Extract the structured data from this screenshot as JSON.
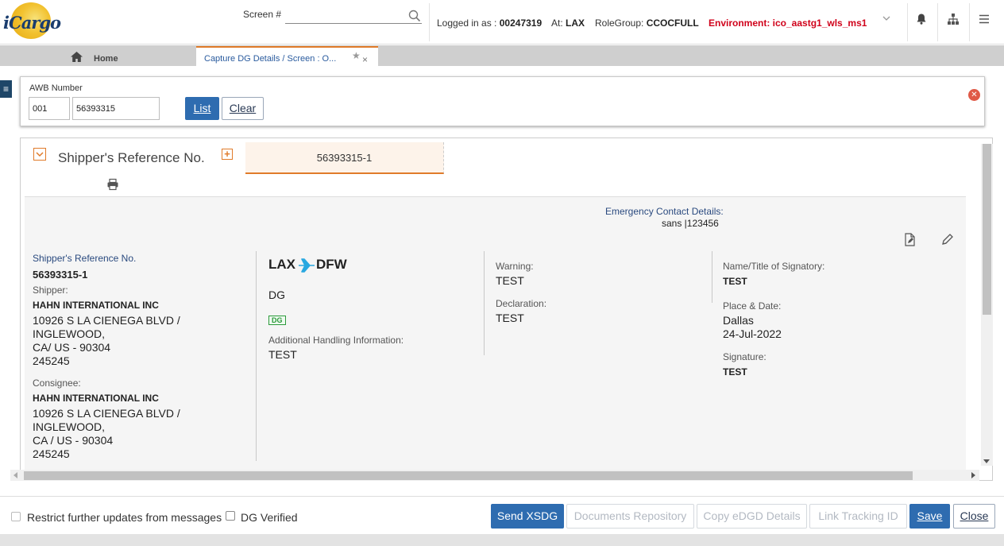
{
  "header": {
    "logo_text": "iCargo",
    "screen_label": "Screen #",
    "screen_value": "",
    "logged_in_label": "Logged in as :",
    "logged_in_value": "00247319",
    "at_label": "At:",
    "at_value": "LAX",
    "rolegroup_label": "RoleGroup:",
    "rolegroup_value": "CCOCFULL",
    "environment": "Environment: ico_aastg1_wls_ms1"
  },
  "tabs": {
    "home_label": "Home",
    "active_label": "Capture DG Details / Screen : O..."
  },
  "awb": {
    "label": "AWB Number",
    "prefix": "001",
    "number": "56393315",
    "list_label": "List",
    "clear_label": "Clear"
  },
  "section": {
    "title": "Shipper's Reference No.",
    "ref_tab": "56393315-1"
  },
  "emergency": {
    "label": "Emergency Contact Details:",
    "value": "sans |123456"
  },
  "shipment": {
    "ref_label": "Shipper's Reference No.",
    "ref_value": "56393315-1",
    "shipper_label": "Shipper:",
    "shipper_name": "HAHN INTERNATIONAL INC",
    "shipper_addr1": "10926 S LA CIENEGA BLVD /",
    "shipper_addr2": "INGLEWOOD,",
    "shipper_addr3": "CA/ US - 90304",
    "shipper_addr4": "245245",
    "consignee_label": "Consignee:",
    "consignee_name": "HAHN INTERNATIONAL INC",
    "consignee_addr1": "10926 S LA CIENEGA BLVD /",
    "consignee_addr2": "INGLEWOOD,",
    "consignee_addr3": "CA / US - 90304",
    "consignee_addr4": "245245"
  },
  "route": {
    "origin": "LAX",
    "destination": "DFW",
    "type": "DG",
    "badge": "DG",
    "handling_label": "Additional Handling Information:",
    "handling_value": "TEST"
  },
  "warning": {
    "warning_label": "Warning:",
    "warning_value": "TEST",
    "declaration_label": "Declaration:",
    "declaration_value": "TEST"
  },
  "signatory": {
    "name_label": "Name/Title of Signatory:",
    "name_value": "TEST",
    "place_label": "Place & Date:",
    "place_value": "Dallas",
    "date_value": "24-Jul-2022",
    "signature_label": "Signature:",
    "signature_value": "TEST"
  },
  "footer": {
    "restrict_label": "Restrict further updates from messages",
    "dg_verified_label": "DG Verified",
    "send_xsdg": "Send XSDG",
    "documents_repository": "Documents Repository",
    "copy_edgd": "Copy eDGD Details",
    "link_tracking": "Link Tracking ID",
    "save": "Save",
    "close": "Close"
  },
  "colors": {
    "primary": "#2e6cb0",
    "accent": "#e07b2a",
    "environment": "#d0021b",
    "label_blue": "#2a4a7f",
    "flight_icon": "#29a8e0"
  }
}
